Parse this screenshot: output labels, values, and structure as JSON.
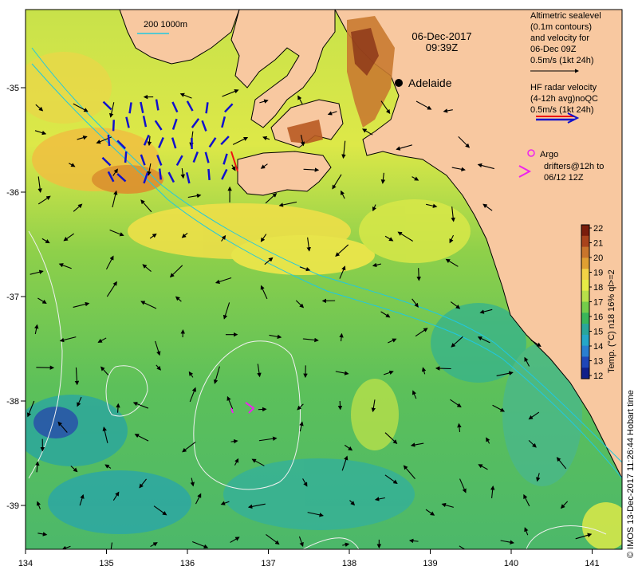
{
  "date_label": "06-Dec-2017",
  "time_label": "09:39Z",
  "scale_label": "200  1000m",
  "city": "Adelaide",
  "legend_altimetry": [
    "Altimetric sealevel",
    "(0.1m contours)",
    "and velocity for",
    "06-Dec 09Z",
    "0.5m/s (1kt 24h)"
  ],
  "legend_hf": [
    "HF radar velocity",
    "(4-12h avg)noQC",
    "0.5m/s (1kt 24h)"
  ],
  "legend_argo": [
    "Argo",
    "drifters@12h to",
    "06/12 12Z"
  ],
  "colorbar": {
    "title": "Temp. (°C) n18 16% ql>=2",
    "ticks": [
      "22",
      "21",
      "20",
      "19",
      "18",
      "17",
      "16",
      "15",
      "14",
      "13",
      "12"
    ],
    "colors": [
      "#7a1d0c",
      "#a9431c",
      "#c9752c",
      "#e0a032",
      "#f2d246",
      "#e6ec46",
      "#b8e04a",
      "#74cc4a",
      "#39b65a",
      "#2aa69a",
      "#26a7c8",
      "#2a7fd0",
      "#1f47b8",
      "#10208a"
    ]
  },
  "axes": {
    "x_ticks": [
      "134",
      "135",
      "136",
      "137",
      "138",
      "139",
      "140",
      "141"
    ],
    "y_ticks": [
      "-35",
      "-36",
      "-37",
      "-38",
      "-39"
    ]
  },
  "credit": "© IMOS 13-Dec-2017 11:26:44 Hobart time",
  "colors": {
    "land": "#f8c8a0",
    "hf_red": "#ee1111",
    "hf_blue": "#1111cc",
    "argo": "#ee22ee"
  }
}
